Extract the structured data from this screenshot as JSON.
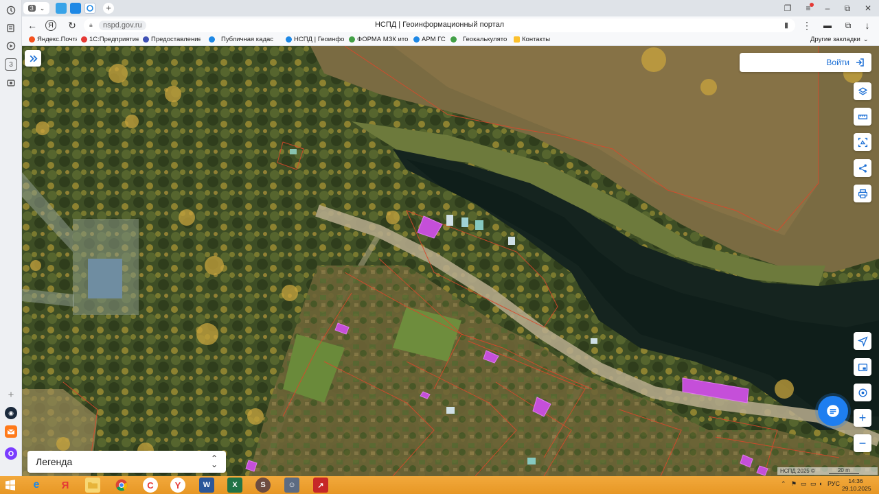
{
  "browser": {
    "tab_count": "3",
    "address": "nspd.gov.ru",
    "page_title": "НСПД | Геоинформационный портал"
  },
  "bookmarks": [
    {
      "label": "Яндекс.Почта",
      "icon": "yandex-mail-icon",
      "color": "#f4511e"
    },
    {
      "label": "1С:Предприятие",
      "icon": "1c-icon",
      "color": "#e53935"
    },
    {
      "label": "Предоставление",
      "icon": "gov-icon",
      "color": "#3f51b5"
    },
    {
      "label": "Публичная кадас",
      "icon": "cadastre-icon",
      "color": "#1e88e5"
    },
    {
      "label": "НСПД | Геоинфор",
      "icon": "nspd-icon",
      "color": "#1e88e5"
    },
    {
      "label": "ФОРМА МЗК ито",
      "icon": "form-icon",
      "color": "#43a047"
    },
    {
      "label": "АРМ ГС",
      "icon": "arm-icon",
      "color": "#1e88e5"
    },
    {
      "label": "Геокалькулято",
      "icon": "geocalc-icon",
      "color": "#43a047"
    },
    {
      "label": "Контакты",
      "icon": "contacts-icon",
      "color": "#fbc02d"
    }
  ],
  "bookmarks_other": "Другие закладки",
  "map": {
    "login_label": "Войти",
    "legend_label": "Легенда",
    "attribution": "НСПД 2025 ©",
    "scale_label": "20 m"
  },
  "taskbar": {
    "lang": "РУС",
    "time": "14:36",
    "date": "29.10.2025"
  }
}
